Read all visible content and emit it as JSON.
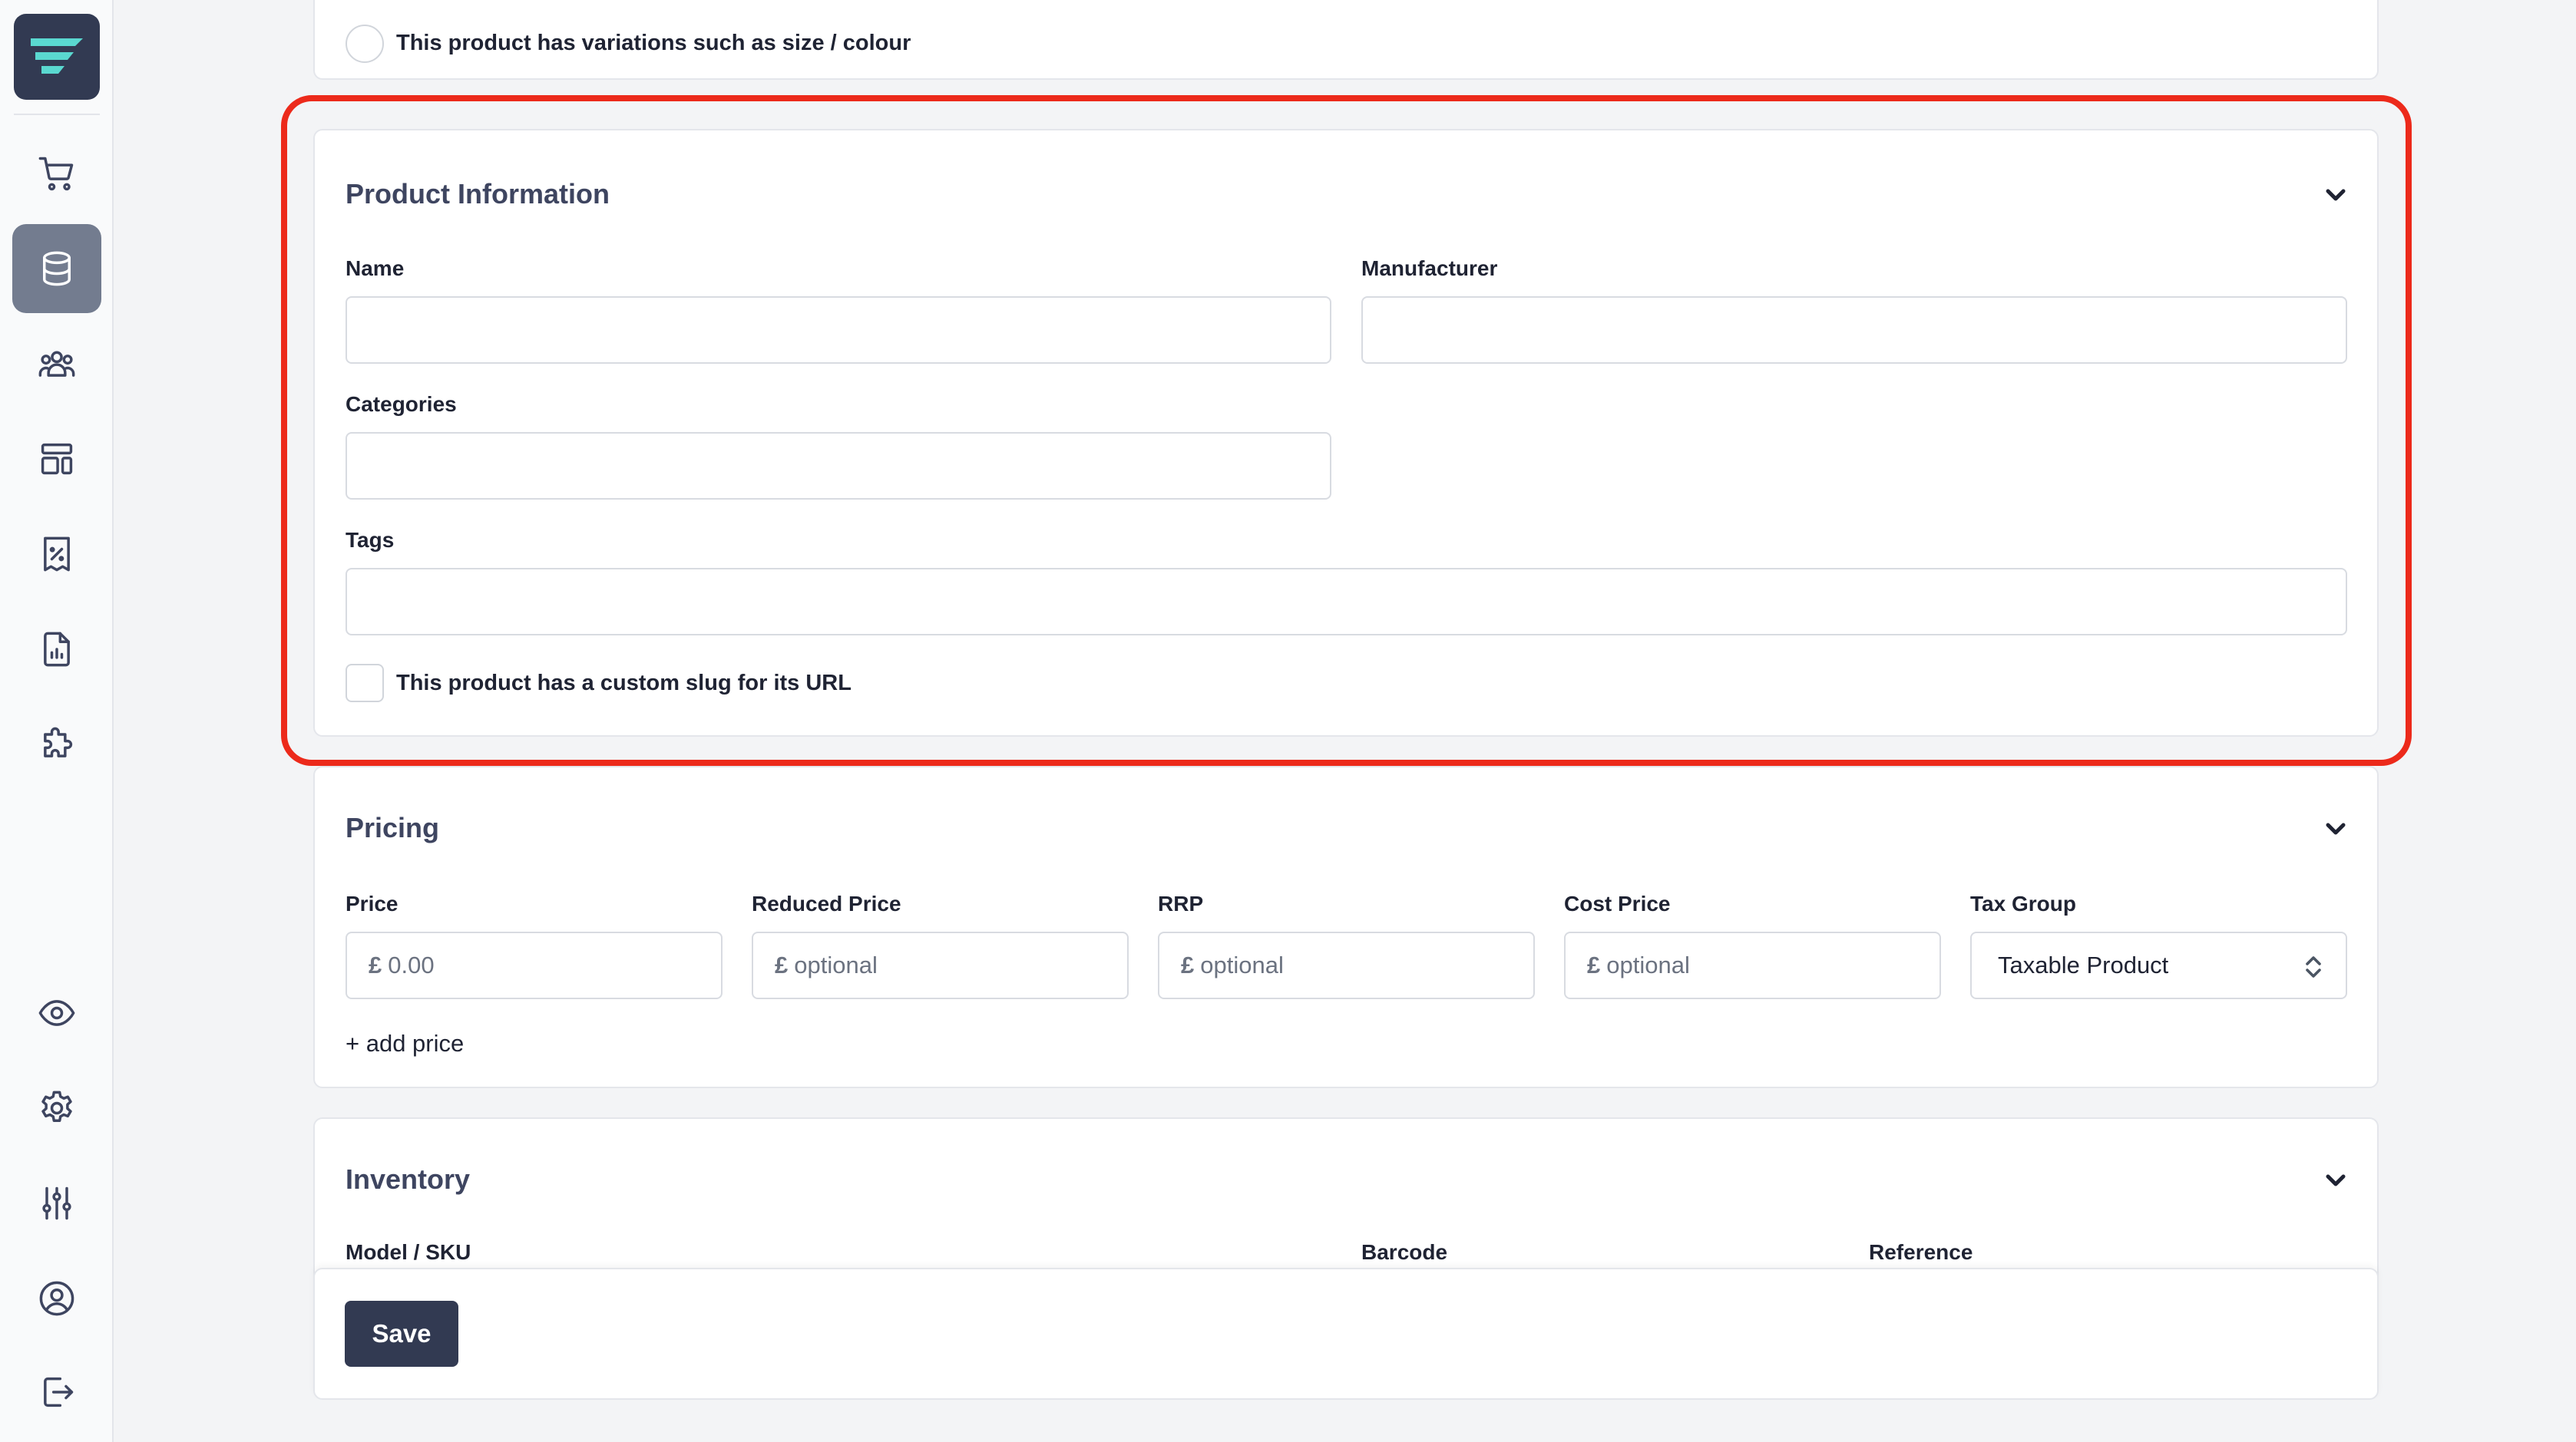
{
  "sidebar": {
    "logo": "app-logo",
    "nav": [
      {
        "name": "cart-icon",
        "active": false
      },
      {
        "name": "database-icon",
        "active": true
      },
      {
        "name": "users-icon",
        "active": false
      },
      {
        "name": "layout-icon",
        "active": false
      },
      {
        "name": "receipt-percent-icon",
        "active": false
      },
      {
        "name": "report-icon",
        "active": false
      },
      {
        "name": "puzzle-icon",
        "active": false
      }
    ],
    "bottom": [
      {
        "name": "eye-icon"
      },
      {
        "name": "gear-icon"
      },
      {
        "name": "sliders-icon"
      },
      {
        "name": "user-circle-icon"
      },
      {
        "name": "logout-icon"
      }
    ]
  },
  "variations": {
    "label": "This product has variations such as size / colour"
  },
  "product_info": {
    "title": "Product Information",
    "name_label": "Name",
    "manufacturer_label": "Manufacturer",
    "categories_label": "Categories",
    "tags_label": "Tags",
    "slug_label": "This product has a custom slug for its URL"
  },
  "pricing": {
    "title": "Pricing",
    "currency": "£",
    "price_label": "Price",
    "price_placeholder": "0.00",
    "reduced_label": "Reduced Price",
    "reduced_placeholder": "optional",
    "rrp_label": "RRP",
    "rrp_placeholder": "optional",
    "cost_label": "Cost Price",
    "cost_placeholder": "optional",
    "tax_label": "Tax Group",
    "tax_value": "Taxable Product",
    "add_price": "+ add price"
  },
  "inventory": {
    "title": "Inventory",
    "sku_label": "Model / SKU",
    "barcode_label": "Barcode",
    "reference_label": "Reference"
  },
  "footer": {
    "save_label": "Save"
  },
  "colors": {
    "highlight": "#ec2a1b",
    "brand": "#323a52",
    "accent": "#4fd1c5"
  }
}
